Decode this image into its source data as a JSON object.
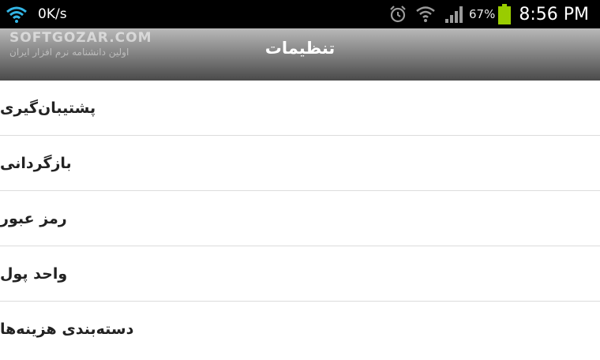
{
  "status_bar": {
    "speed": "0K/s",
    "battery_percent": "67%",
    "time": "8:56 PM",
    "icons": [
      "wifi-icon",
      "alarm-icon",
      "wifi-icon",
      "signal-icon",
      "battery-icon"
    ],
    "battery_color": "#99cc00"
  },
  "watermark": {
    "logo": "SOFTGOZAR.COM",
    "subtitle": "اولین دانشنامه نرم افزار ایران"
  },
  "action_bar": {
    "title": "تنظیمات"
  },
  "settings": {
    "items": [
      {
        "label": "پشتیبان‌گیری"
      },
      {
        "label": "بازگردانی"
      },
      {
        "label": "رمز عبور"
      },
      {
        "label": "واحد پول"
      },
      {
        "label": "دسته‌بندی هزینه‌ها"
      }
    ]
  }
}
